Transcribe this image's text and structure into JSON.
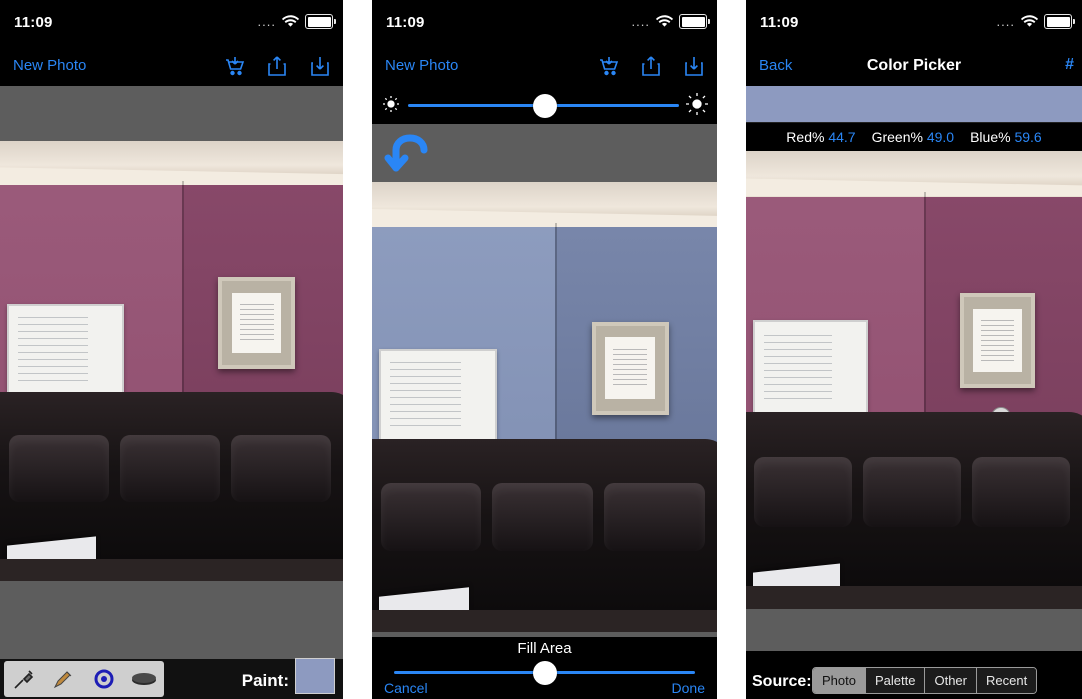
{
  "screens": [
    {
      "id": "new-photo",
      "status": {
        "time": "11:09",
        "dots": "....",
        "wifi": "wifi-icon",
        "battery": "battery-full-icon"
      },
      "nav": {
        "left_label": "New Photo",
        "icons": [
          "cart-download-icon",
          "share-icon",
          "save-download-icon"
        ]
      },
      "bottom": {
        "paint_label": "Paint:",
        "swatch_color": "#8d9ac0",
        "tools": [
          "eyedropper-icon",
          "paintbrush-icon",
          "fill-circle-icon",
          "eraser-icon"
        ]
      }
    },
    {
      "id": "fill-area",
      "status": {
        "time": "11:09",
        "dots": "....",
        "wifi": "wifi-icon",
        "battery": "battery-full-icon"
      },
      "nav": {
        "left_label": "New Photo",
        "icons": [
          "cart-download-icon",
          "share-icon",
          "save-download-icon"
        ]
      },
      "brightness": {
        "left_icon": "sun-small-icon",
        "right_icon": "sun-large-icon",
        "value_pct": 50
      },
      "undo_icon": "undo-arrow-icon",
      "bottom": {
        "title": "Fill Area",
        "slider_pct": 50,
        "cancel_label": "Cancel",
        "done_label": "Done"
      }
    },
    {
      "id": "color-picker",
      "status": {
        "time": "11:09",
        "dots": "....",
        "wifi": "wifi-icon",
        "battery": "battery-full-icon"
      },
      "nav": {
        "back_label": "Back",
        "title": "Color Picker",
        "right_label": "#"
      },
      "preview_color": "#8d9ac0",
      "channels": [
        {
          "label": "Red%",
          "value": "44.7"
        },
        {
          "label": "Green%",
          "value": "49.0"
        },
        {
          "label": "Blue%",
          "value": "59.6"
        }
      ],
      "bottom": {
        "source_label": "Source:",
        "segments": [
          "Photo",
          "Palette",
          "Other",
          "Recent"
        ],
        "selected": "Photo"
      }
    }
  ],
  "theme": {
    "accent": "#2a86f5",
    "bar_bg": "#000000",
    "gray_band": "#5d5d5d"
  }
}
